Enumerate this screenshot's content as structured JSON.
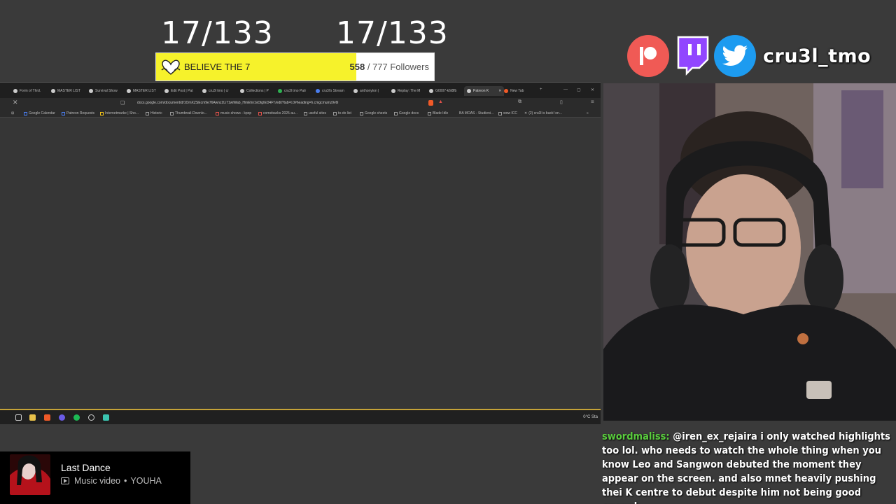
{
  "counters": {
    "left": "17/133",
    "right": "17/133"
  },
  "follower_goal": {
    "title": "BELIEVE THE 7",
    "current": "558",
    "target": "/ 777 Followers",
    "progress": 0.72,
    "fill_color": "#f6f22b"
  },
  "social": {
    "handle": "cru3l_tmo",
    "icons": [
      "patreon-icon",
      "twitch-icon",
      "twitter-icon"
    ]
  },
  "browser": {
    "tabs": [
      "Form of Thrd.",
      "MASTER LIST",
      "Survival Show",
      "MASTER LIST",
      "Edit Post | Pat",
      "cru3l tmo | cr",
      "Collections | P",
      "cru3l tmo Patr",
      "cru3l's Stream",
      "anthonyton |",
      "Replay: The M",
      "G0007-k6t8fb",
      "Patreon K",
      "New Tab"
    ],
    "url": "docs.google.com/document/d/1OmXZSEcm9e76Awnz2Li71wiWab_HmEhn1vDtgIED4FT/edit?tab=t.0#heading=h.cmgcmumz9v6l",
    "bookmarks": [
      "Google Calendar",
      "Patreon Requests",
      "Internetmarke | Sho...",
      "Historic",
      "Thumbnail-Downlo...",
      "music-shows - kpop",
      "comebacks 2025 au...",
      "useful sites",
      "to-do list",
      "Google sheets",
      "Google docs",
      "Blade Idle",
      "BA MOAS - Studieni...",
      "wow ICC",
      "(2) cru3l is back! on..."
    ],
    "weather": "0°C Sta"
  },
  "chat": {
    "username": "swordmaliss:",
    "message": "@iren_ex_rejaira i only watched highlights too lol. who needs to watch the whole thing when you know Leo and Sangwon debuted the moment they appear on the screen. and also mnet heavily pushing thei K centre to debut despite him not being good enough"
  },
  "now_playing": {
    "title": "Last Dance",
    "type": "Music video",
    "separator": "•",
    "artist": "YOUHA"
  },
  "colors": {
    "background": "#3a3a3a",
    "goal_fill": "#f6f22b",
    "chat_username": "#5acd3e",
    "taskbar_accent": "#c5a338"
  }
}
